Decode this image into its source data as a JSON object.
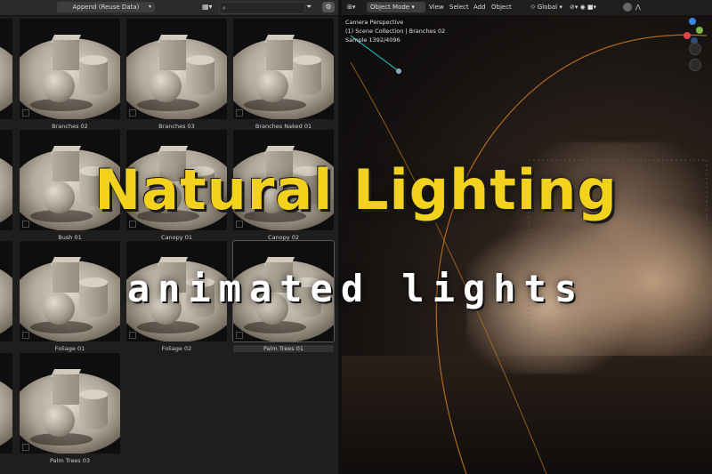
{
  "browser": {
    "import_method": "Append (Reuse Data)",
    "search_placeholder": "",
    "assets": [
      {
        "name": "Branches 02"
      },
      {
        "name": "Branches 03"
      },
      {
        "name": "Branches Naked 01"
      },
      {
        "name": "Bush 01"
      },
      {
        "name": "Canopy 01"
      },
      {
        "name": "Canopy 02"
      },
      {
        "name": "Foliage 01"
      },
      {
        "name": "Foliage 02"
      },
      {
        "name": "Palm Trees 01"
      },
      {
        "name": "Palm Trees 03"
      }
    ]
  },
  "viewport": {
    "mode": "Object Mode",
    "menus": {
      "view": "View",
      "select": "Select",
      "add": "Add",
      "object": "Object"
    },
    "orientation": "Global",
    "info": {
      "line1": "Camera Perspective",
      "line2": "(1) Scene Collection | Branches 02",
      "line3": "Sample 1392/4096"
    },
    "gizmo_axes": {
      "x": "#e4434d",
      "y": "#7fb93a",
      "z": "#3f86e3"
    }
  },
  "overlay": {
    "title": "Natural Lighting",
    "subtitle": "animated lights",
    "title_color": "#f3d21d",
    "subtitle_color": "#ffffff"
  }
}
